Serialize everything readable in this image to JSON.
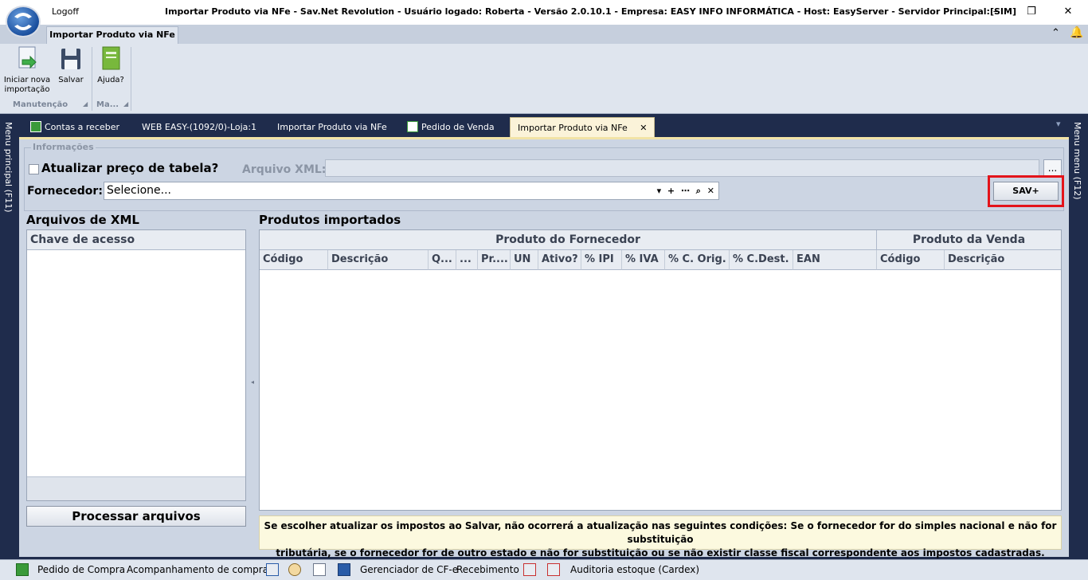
{
  "titlebar": {
    "logoff": "Logoff",
    "title": "Importar Produto via NFe - Sav.Net Revolution - Usuário logado: Roberta - Versão 2.0.10.1 - Empresa: EASY INFO INFORMÁTICA - Host: EasyServer - Servidor Principal:[SIM]",
    "minimize": "–",
    "restore": "❐",
    "close": "✕"
  },
  "ribbon": {
    "tab": "Importar Produto via NFe",
    "collapse": "⌃",
    "bell": "🔔",
    "buttons": {
      "nova_importacao_l1": "Iniciar nova",
      "nova_importacao_l2": "importação",
      "salvar": "Salvar",
      "ajuda": "Ajuda?"
    },
    "groups": {
      "manutencao": "Manutenção",
      "ma": "Ma..."
    },
    "launcher": "◢"
  },
  "sidebars": {
    "left": "Menu principal (F11)",
    "right": "Menu menu (F12)"
  },
  "doc_tabs": {
    "items": [
      "Contas a receber",
      "WEB EASY-(1092/0)-Loja:1",
      "Importar Produto via NFe",
      "Pedido de Venda",
      "Importar Produto via NFe"
    ],
    "close": "✕",
    "overflow": "▾"
  },
  "form": {
    "legend": "Informações",
    "checkbox_label": "Atualizar preço de tabela?",
    "xml_label": "Arquivo XML:",
    "xml_value": "",
    "browse": "...",
    "fornecedor_label": "Fornecedor:",
    "fornecedor_value": "Selecione...",
    "fornecedor_icons": "▾ + ⋯ ⌕ ✕",
    "sav_button": "SAV+"
  },
  "xml_files": {
    "title": "Arquivos de XML",
    "column": "Chave de acesso",
    "process_button": "Processar arquivos"
  },
  "products": {
    "title": "Produtos importados",
    "band_fornecedor": "Produto do Fornecedor",
    "band_venda": "Produto da Venda",
    "columns": [
      "Código",
      "Descrição",
      "Q...",
      "...",
      "Pr....",
      "UN",
      "Ativo?",
      "% IPI",
      "% IVA",
      "% C. Orig.",
      "% C.Dest.",
      "EAN",
      "Código",
      "Descrição"
    ]
  },
  "note": {
    "line1": "Se escolher atualizar os impostos ao Salvar, não ocorrerá a atualização nas seguintes condições: Se o fornecedor for do simples nacional e não for substituição",
    "line2": "tributária, se o fornecedor for de outro estado e não for substituição ou se não existir classe fiscal correspondente aos impostos cadastradas."
  },
  "statusbar": {
    "pedido_compra": "Pedido de Compra",
    "acompanhamento": "Acompanhamento de compra",
    "gerenciador": "Gerenciador de CF-e",
    "recebimento": "Recebimento",
    "auditoria": "Auditoria estoque (Cardex)"
  },
  "colors": {
    "dark_bg": "#1f2c4c",
    "panel": "#ccd5e3",
    "highlight": "#e3141b",
    "note_bg": "#fcf9df"
  }
}
